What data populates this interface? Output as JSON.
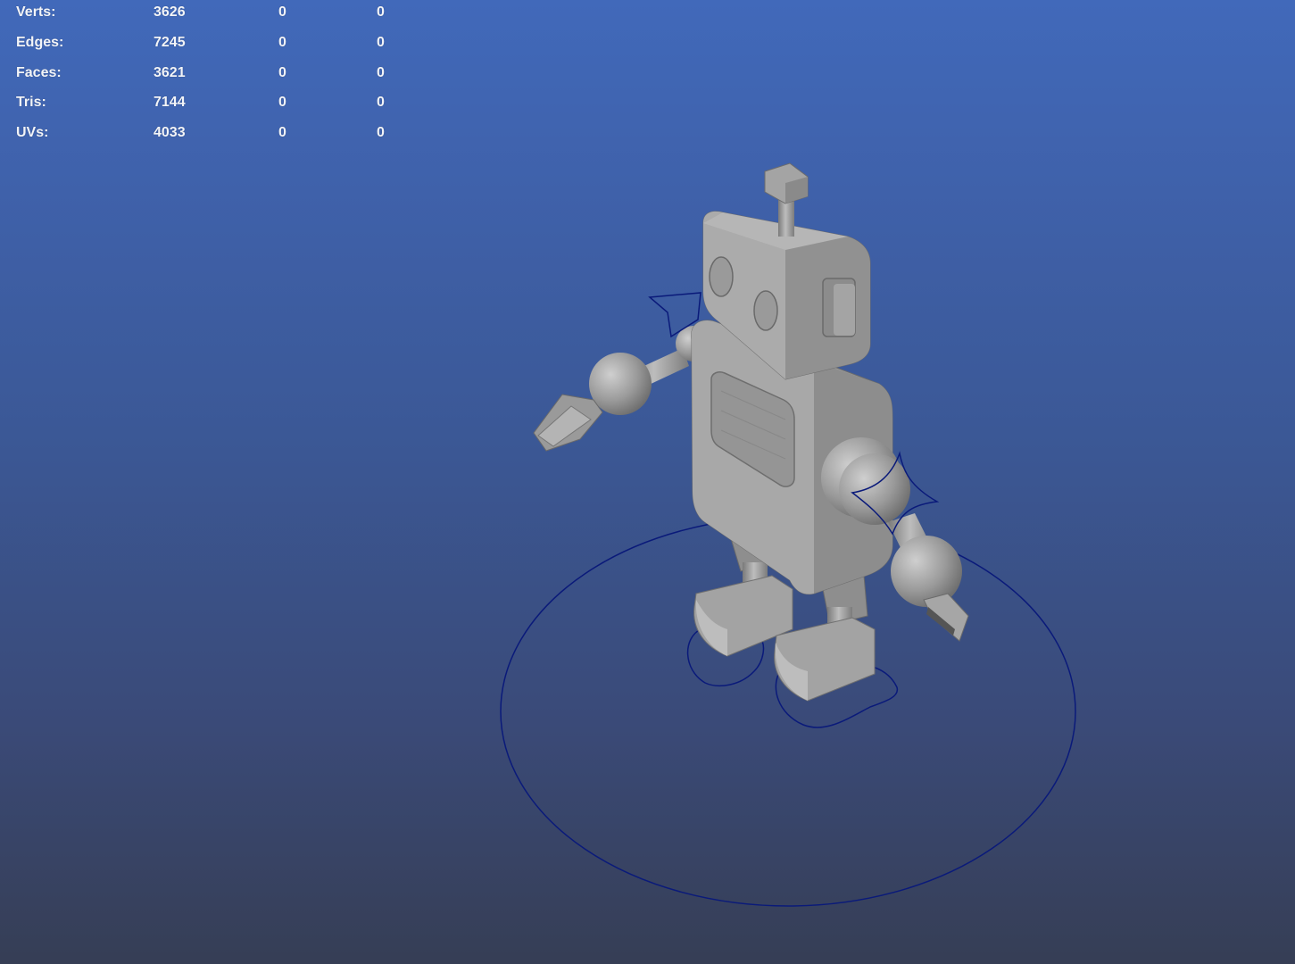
{
  "app": {
    "view": "perspective viewport",
    "background_top": "#4169ba",
    "background_bottom": "#363e55"
  },
  "hud": {
    "rows": [
      {
        "label": "Verts:",
        "v1": "3626",
        "v2": "0",
        "v3": "0"
      },
      {
        "label": "Edges:",
        "v1": "7245",
        "v2": "0",
        "v3": "0"
      },
      {
        "label": "Faces:",
        "v1": "3621",
        "v2": "0",
        "v3": "0"
      },
      {
        "label": "Tris:",
        "v1": "7144",
        "v2": "0",
        "v3": "0"
      },
      {
        "label": "UVs:",
        "v1": "4033",
        "v2": "0",
        "v3": "0"
      }
    ]
  },
  "scene": {
    "model_color": "#9b9b9b",
    "control_curve_color": "#0a1a7a"
  }
}
